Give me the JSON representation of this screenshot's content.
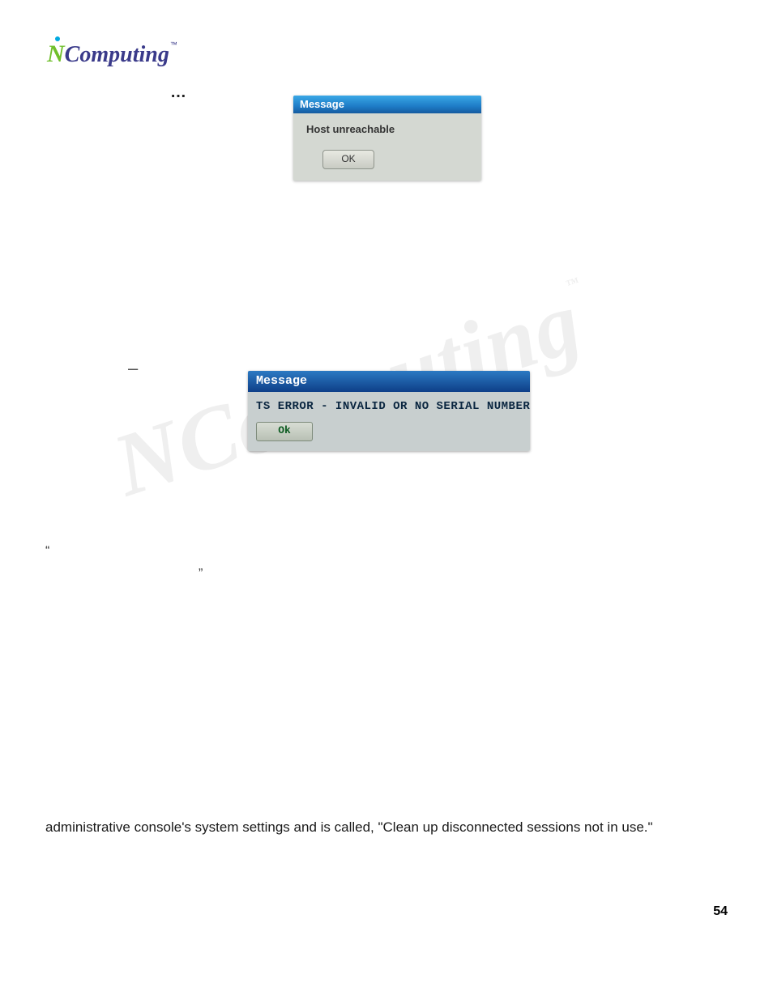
{
  "logo": {
    "letter": "N",
    "word": "Computing",
    "trademark": "™"
  },
  "artifacts": {
    "ellipsis": "…",
    "dash": "–",
    "left_quote": "“",
    "right_quote": "”"
  },
  "dialog1": {
    "title": "Message",
    "message": "Host unreachable",
    "button": "OK"
  },
  "dialog2": {
    "title": "Message",
    "message": "TS ERROR - INVALID OR NO SERIAL NUMBER !",
    "button": "Ok"
  },
  "watermark": {
    "text": "NComputing",
    "tm": "™"
  },
  "paragraph": "administrative console's system settings and is called, \"Clean up disconnected sessions not in use.\"",
  "page_number": "54"
}
